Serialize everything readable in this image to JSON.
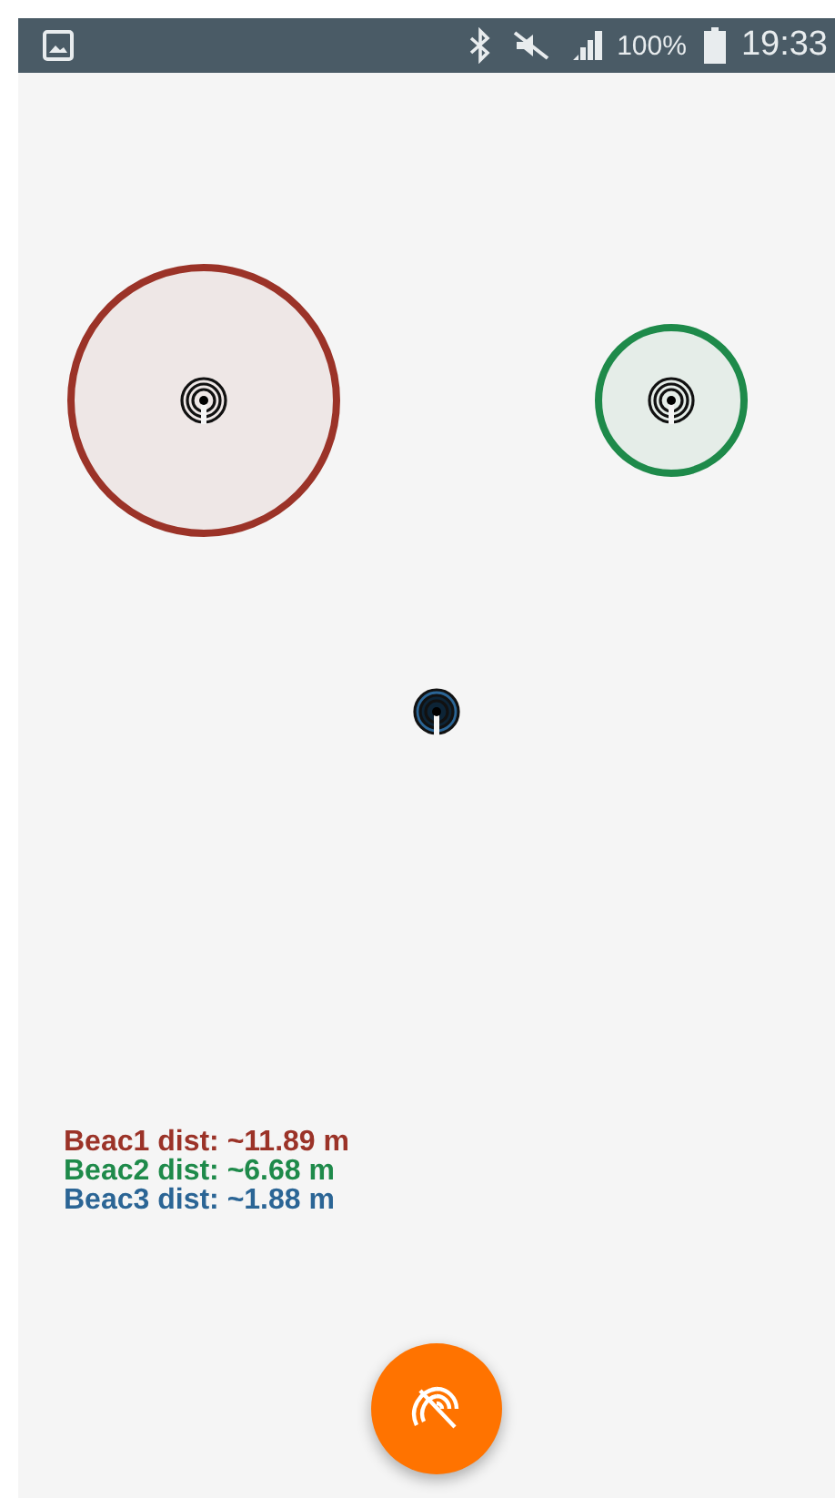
{
  "status_bar": {
    "battery": "100%",
    "time": "19:33"
  },
  "beacons": [
    {
      "label": "Beac1 dist: ~11.89 m",
      "color": "#9b3328"
    },
    {
      "label": "Beac2 dist: ~6.68 m",
      "color": "#1e8a4a"
    },
    {
      "label": "Beac3 dist: ~1.88 m",
      "color": "#2b6595"
    }
  ]
}
